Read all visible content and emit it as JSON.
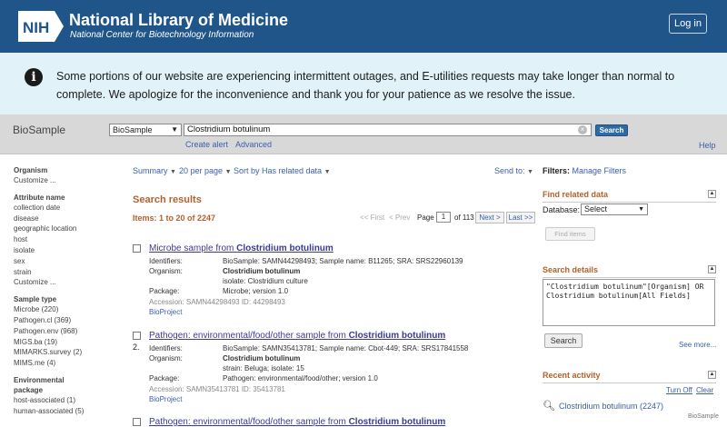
{
  "header": {
    "logo_text": "NIH",
    "title": "National Library of Medicine",
    "subtitle": "National Center for Biotechnology Information",
    "login_label": "Log in"
  },
  "alert": {
    "icon": "info-icon",
    "text": "Some portions of our website are experiencing intermittent outages, and E-utilities requests may take longer than normal to complete. We apologize for the inconvenience and thank you for your patience as we resolve the issue."
  },
  "search": {
    "database_label": "BioSample",
    "database_selected": "BioSample",
    "query": "Clostridium botulinum",
    "search_button": "Search",
    "create_alert": "Create alert",
    "advanced": "Advanced",
    "help": "Help"
  },
  "facets": [
    {
      "heading": "Organism",
      "items": [
        "Customize ..."
      ]
    },
    {
      "heading": "Attribute name",
      "items": [
        "collection date",
        "disease",
        "geographic location",
        "host",
        "isolate",
        "sex",
        "strain",
        "Customize ..."
      ]
    },
    {
      "heading": "Sample type",
      "items": [
        "Microbe (220)",
        "Pathogen.cl (369)",
        "Pathogen.env (968)",
        "MIGS.ba (19)",
        "MIMARKS.survey (2)",
        "MIMS.me (4)"
      ]
    },
    {
      "heading": "Environmental package",
      "items": [
        "host-associated (1)",
        "human-associated (5)"
      ]
    }
  ],
  "toolbar": {
    "summary": "Summary",
    "per_page": "20 per page",
    "sort": "Sort by Has related data",
    "send_to": "Send to:"
  },
  "results": {
    "title": "Search results",
    "items_count": "Items: 1 to 20 of 2247",
    "pager": {
      "first": "<< First",
      "prev": "< Prev",
      "page_label": "Page",
      "page_value": "1",
      "of_label": "of 113",
      "next": "Next >",
      "last": "Last >>"
    },
    "items": [
      {
        "num": "",
        "title_prefix": "Microbe sample from ",
        "title_bold": "Clostridium botulinum",
        "identifiers_label": "Identifiers:",
        "identifiers": "BioSample: SAMN44298493; Sample name: B11265; SRA: SRS22960139",
        "organism_label": "Organism:",
        "organism": "Clostridium botulinum",
        "extra": "isolate: Clostridium culture",
        "package_label": "Package:",
        "package": "Microbe; version 1.0",
        "accession": "Accession: SAMN44298493   ID: 44298493",
        "bioproject": "BioProject"
      },
      {
        "num": "2.",
        "title_prefix": "Pathogen: environmental/food/other sample from ",
        "title_bold": "Clostridium botulinum",
        "identifiers_label": "Identifiers:",
        "identifiers": "BioSample: SAMN35413781; Sample name: Cbot-449; SRA: SRS17841558",
        "organism_label": "Organism:",
        "organism": "Clostridium botulinum",
        "extra": "strain: Beluga; isolate: 15",
        "package_label": "Package:",
        "package": "Pathogen: environmental/food/other; version 1.0",
        "accession": "Accession: SAMN35413781   ID: 35413781",
        "bioproject": "BioProject"
      },
      {
        "num": "",
        "title_prefix": "Pathogen: environmental/food/other sample from ",
        "title_bold": "Clostridium botulinum"
      }
    ]
  },
  "sidebar": {
    "filters_label": "Filters:",
    "manage_filters": "Manage Filters",
    "find_related": {
      "heading": "Find related data",
      "database_label": "Database:",
      "database_selected": "Select",
      "find_items": "Find items"
    },
    "search_details": {
      "heading": "Search details",
      "query_text": "\"Clostridium botulinum\"[Organism] OR Clostridium botulinum[All Fields]",
      "search_button": "Search",
      "see_more": "See more..."
    },
    "recent_activity": {
      "heading": "Recent activity",
      "turn_off": "Turn Off",
      "clear": "Clear",
      "item": "Clostridium botulinum (2247)",
      "item_db": "BioSample"
    }
  },
  "colors": {
    "header_bg": "#20558a",
    "alert_bg": "#e1f3f8",
    "accent_orange": "#b5602a",
    "link_blue": "#3a5fa8"
  }
}
